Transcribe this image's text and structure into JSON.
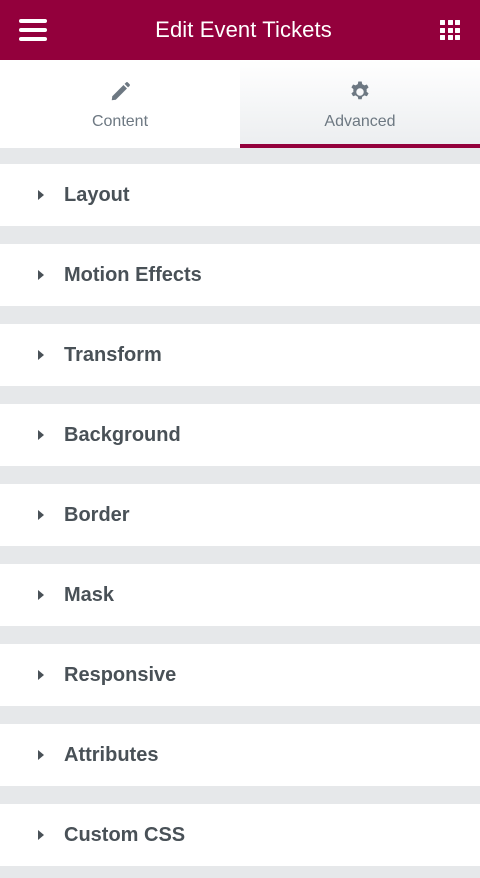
{
  "header": {
    "title": "Edit Event Tickets",
    "menu_icon": "hamburger-menu-icon",
    "apps_icon": "grid-apps-icon",
    "background_color": "#93003c"
  },
  "tabs": [
    {
      "label": "Content",
      "icon": "pencil-icon",
      "active": false
    },
    {
      "label": "Advanced",
      "icon": "gear-icon",
      "active": true
    }
  ],
  "sections": [
    {
      "label": "Layout"
    },
    {
      "label": "Motion Effects"
    },
    {
      "label": "Transform"
    },
    {
      "label": "Background"
    },
    {
      "label": "Border"
    },
    {
      "label": "Mask"
    },
    {
      "label": "Responsive"
    },
    {
      "label": "Attributes"
    },
    {
      "label": "Custom CSS"
    }
  ],
  "colors": {
    "accent": "#93003c",
    "text_dark": "#495157",
    "text_muted": "#6d7882",
    "panel_bg": "#e6e8ea"
  }
}
